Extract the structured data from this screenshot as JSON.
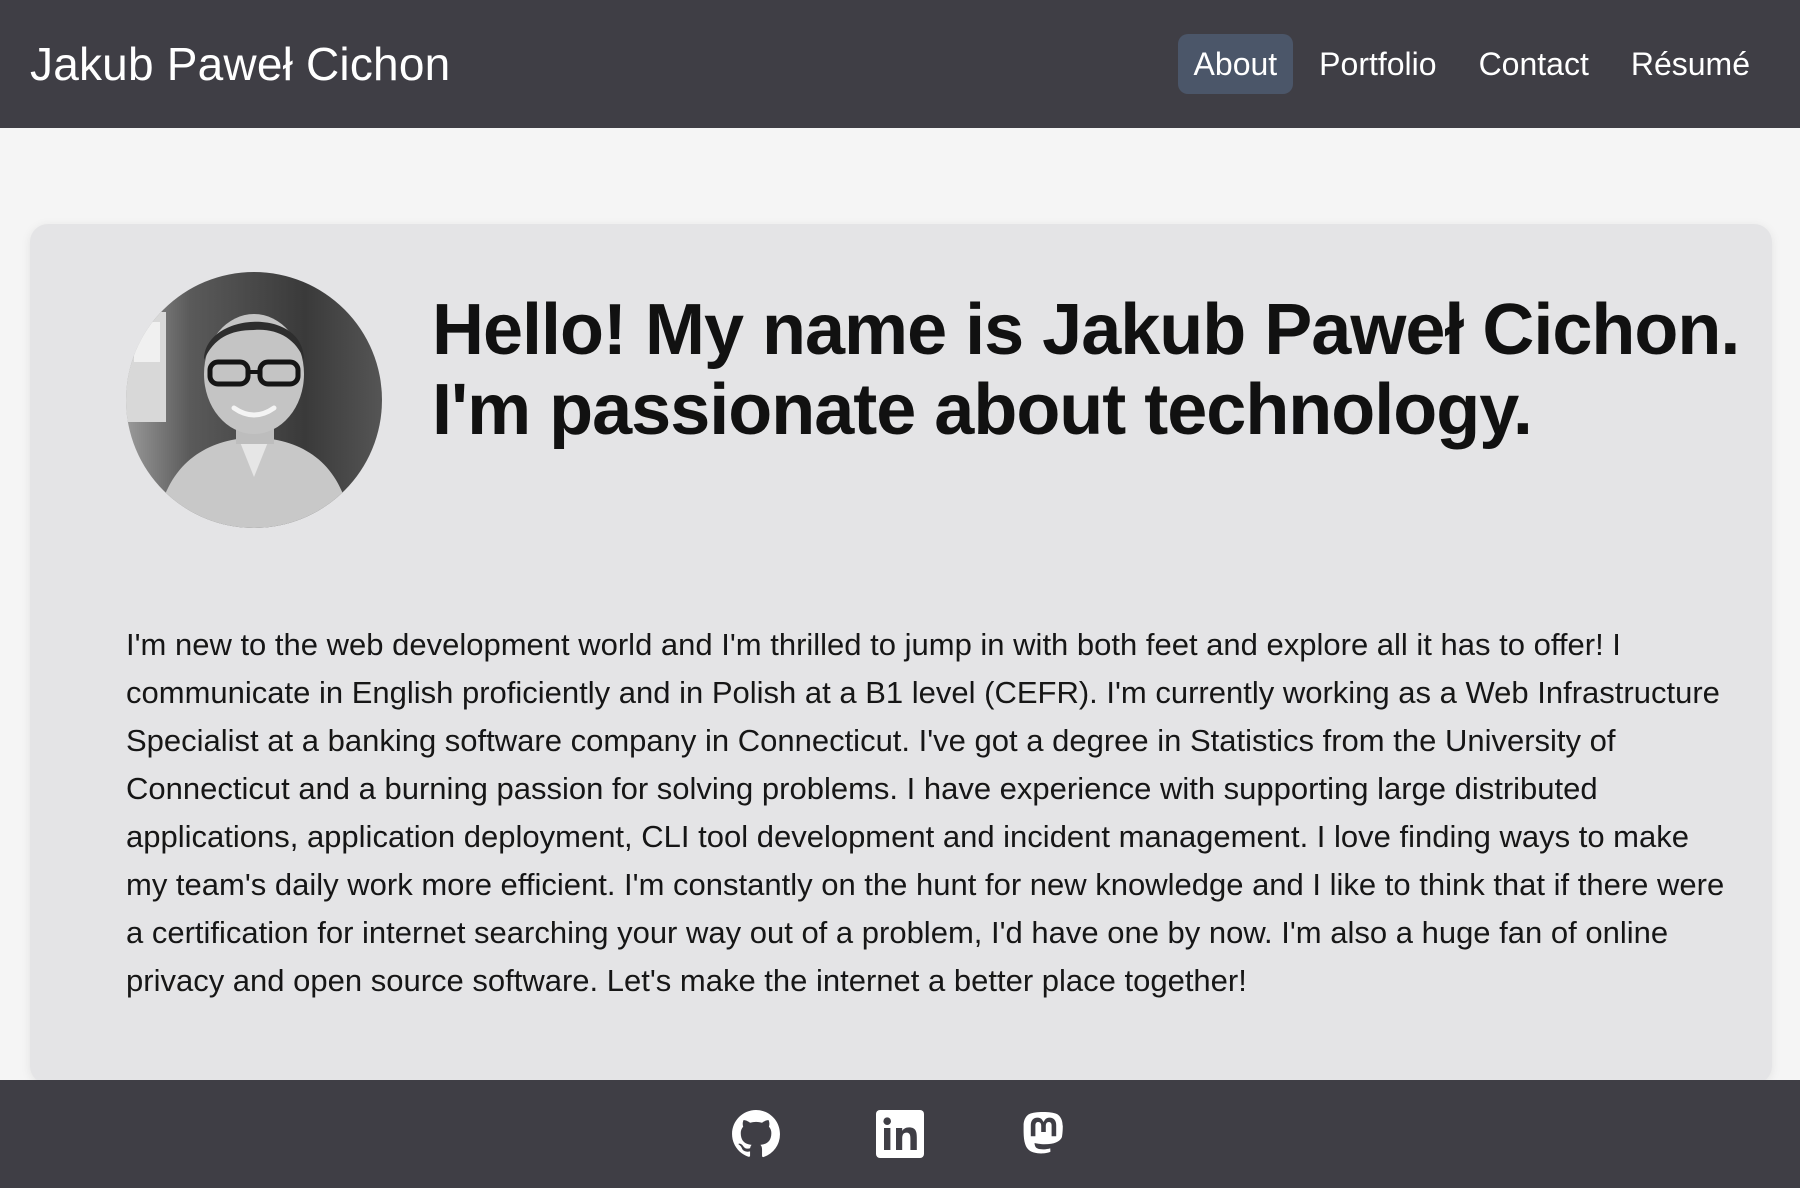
{
  "header": {
    "brand": "Jakub Paweł Cichon",
    "nav": [
      {
        "label": "About",
        "active": true
      },
      {
        "label": "Portfolio",
        "active": false
      },
      {
        "label": "Contact",
        "active": false
      },
      {
        "label": "Résumé",
        "active": false
      }
    ]
  },
  "hero": {
    "avatar_icon": "profile-photo",
    "headline_line1": "Hello! My name is Jakub Paweł Cichon.",
    "headline_line2": "I'm passionate about technology."
  },
  "bio": "I'm new to the web development world and I'm thrilled to jump in with both feet and explore all it has to offer! I communicate in English proficiently and in Polish at a B1 level (CEFR). I'm currently working as a Web Infrastructure Specialist at a banking software company in Connecticut. I've got a degree in Statistics from the University of Connecticut and a burning passion for solving problems. I have experience with supporting large distributed applications, application deployment, CLI tool development and incident management. I love finding ways to make my team's daily work more efficient. I'm constantly on the hunt for new knowledge and I like to think that if there were a certification for internet searching your way out of a problem, I'd have one by now. I'm also a huge fan of online privacy and open source software. Let's make the internet a better place together!",
  "footer": {
    "social": [
      {
        "icon": "github-icon"
      },
      {
        "icon": "linkedin-icon"
      },
      {
        "icon": "mastodon-icon"
      }
    ]
  },
  "colors": {
    "bar": "#3f3e45",
    "active_nav": "#4b5669",
    "card": "#e4e4e6",
    "page": "#f5f5f5"
  }
}
